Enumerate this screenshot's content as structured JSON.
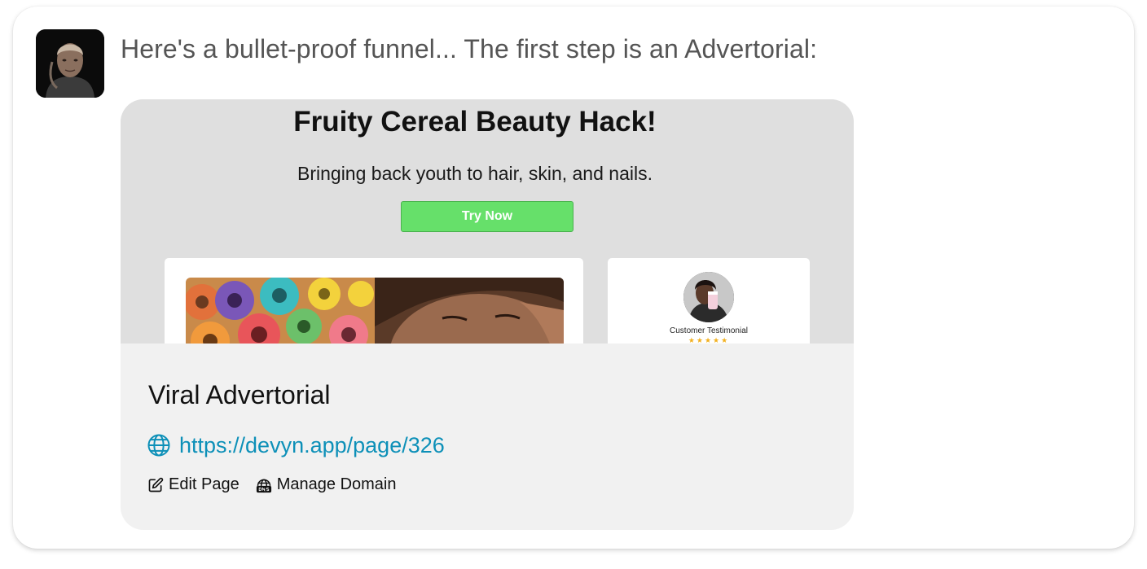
{
  "message": {
    "text": "Here's a bullet-proof funnel... The first step is an Advertorial:"
  },
  "preview": {
    "title": "Fruity Cereal Beauty Hack!",
    "subtitle": "Bringing back youth to hair, skin, and nails.",
    "cta_label": "Try Now",
    "testimonial_label": "Customer Testimonial",
    "testimonial_stars": "★★★★★",
    "colors": {
      "cta": "#66e06a",
      "background": "#dfdfdf",
      "stars": "#f2b01e"
    }
  },
  "page": {
    "name": "Viral Advertorial",
    "url": "https://devyn.app/page/326",
    "url_color": "#0d90b8",
    "url_icon": "globe-icon"
  },
  "actions": {
    "edit_label": "Edit Page",
    "edit_icon": "edit-icon",
    "domain_label": "Manage Domain",
    "domain_icon": "dns-icon"
  }
}
